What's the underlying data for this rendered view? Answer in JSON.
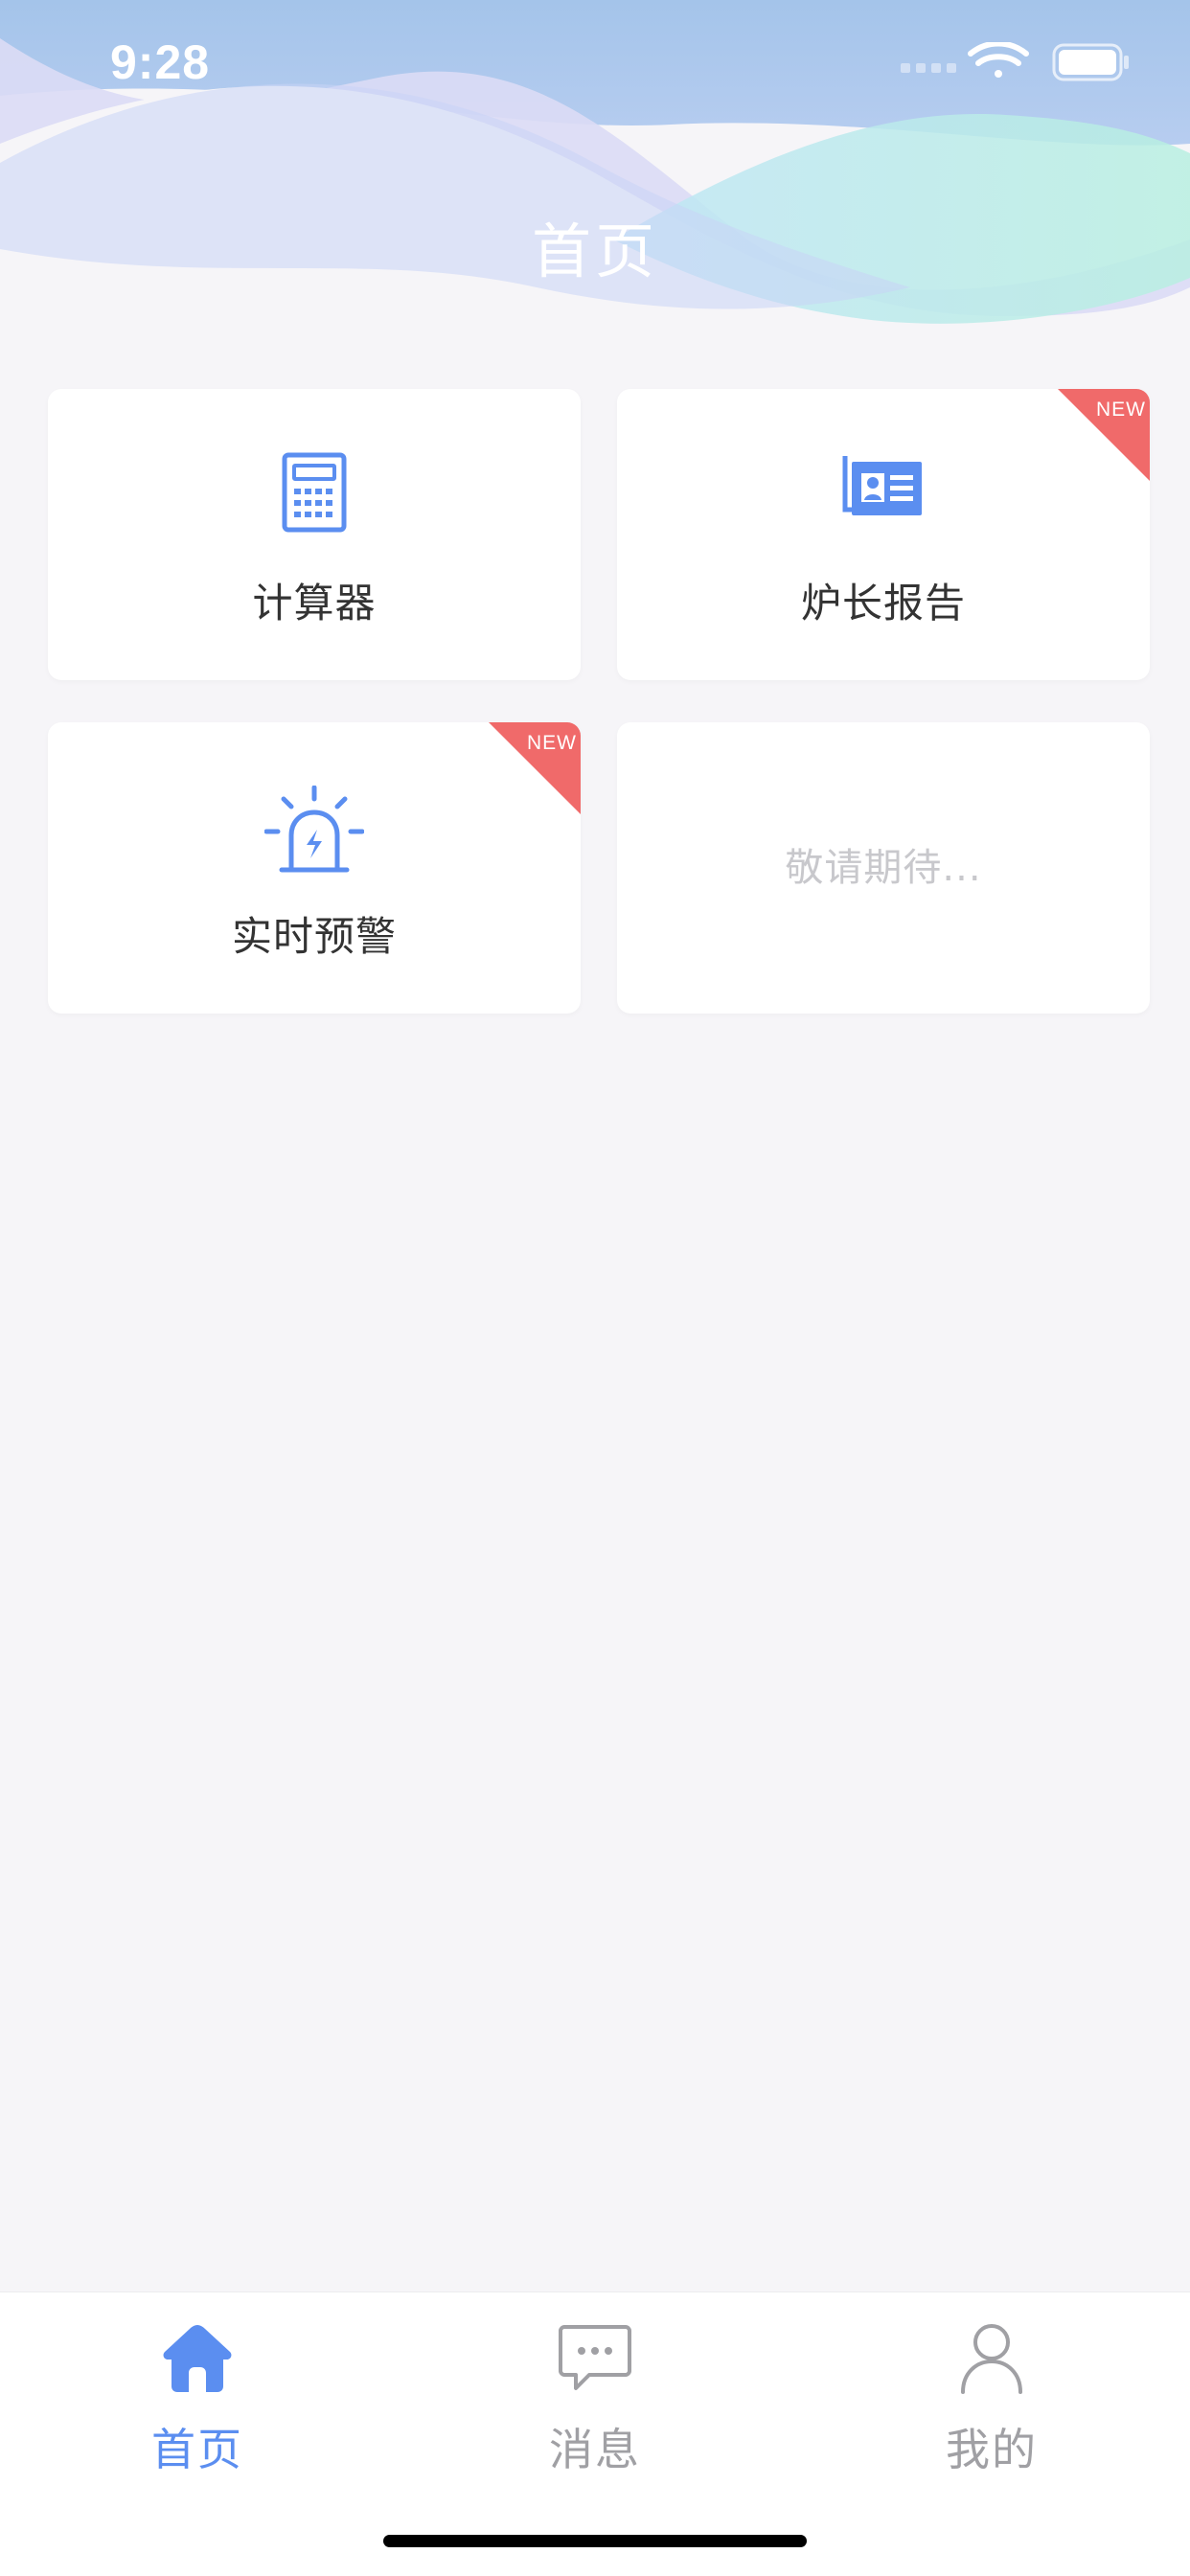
{
  "status_bar": {
    "time": "9:28"
  },
  "header": {
    "title": "首页"
  },
  "cards": [
    {
      "label": "计算器",
      "icon": "calculator-icon",
      "badge": ""
    },
    {
      "label": "炉长报告",
      "icon": "id-card-icon",
      "badge": "NEW"
    },
    {
      "label": "实时预警",
      "icon": "alarm-light-icon",
      "badge": "NEW"
    },
    {
      "label": "",
      "placeholder": "敬请期待..."
    }
  ],
  "tab_bar": {
    "items": [
      {
        "label": "首页",
        "icon": "home-icon",
        "active": true
      },
      {
        "label": "消息",
        "icon": "message-icon",
        "active": false
      },
      {
        "label": "我的",
        "icon": "user-icon",
        "active": false
      }
    ]
  },
  "colors": {
    "accent": "#5b8ef0",
    "badge": "#f06a6a",
    "background": "#f6f5f8"
  }
}
